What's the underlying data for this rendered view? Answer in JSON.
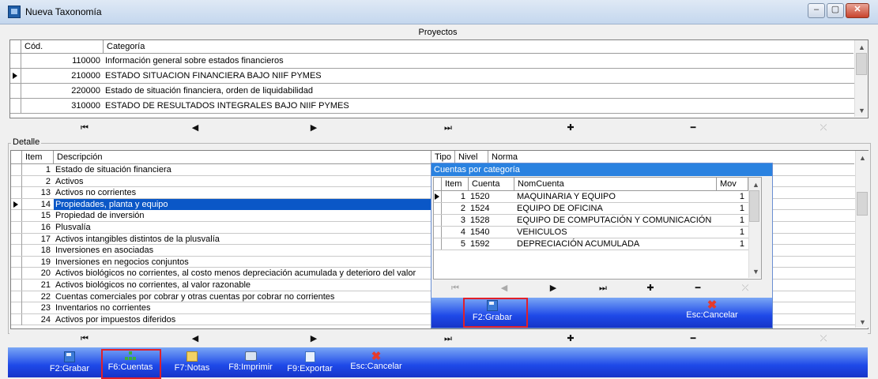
{
  "window": {
    "title": "Nueva Taxonomía",
    "min": "‒",
    "max": "▢",
    "close": "✕"
  },
  "proyectos": {
    "title": "Proyectos",
    "columns": {
      "cod": "Cód.",
      "categoria": "Categoría"
    },
    "rows": [
      {
        "cod": "110000",
        "categoria": "Información general sobre estados financieros"
      },
      {
        "cod": "210000",
        "categoria": "ESTADO SITUACION FINANCIERA BAJO NIIF PYMES"
      },
      {
        "cod": "220000",
        "categoria": "Estado de situación financiera, orden de liquidabilidad"
      },
      {
        "cod": "310000",
        "categoria": "ESTADO DE RESULTADOS INTEGRALES BAJO NIIF PYMES"
      }
    ],
    "current_row": 1
  },
  "navigator": {
    "first": "⏮",
    "prior": "◀",
    "next": "▶",
    "last": "⏭",
    "insert": "✚",
    "delete": "━",
    "cancel": "⤫"
  },
  "detalle": {
    "title": "Detalle",
    "columns": {
      "item": "Item",
      "descripcion": "Descripción",
      "tipo": "Tipo",
      "nivel": "Nivel",
      "norma": "Norma"
    },
    "rows": [
      {
        "item": "1",
        "descripcion": "Estado de situación financiera"
      },
      {
        "item": "2",
        "descripcion": "Activos"
      },
      {
        "item": "13",
        "descripcion": "Activos no corrientes"
      },
      {
        "item": "14",
        "descripcion": "Propiedades, planta y equipo"
      },
      {
        "item": "15",
        "descripcion": "Propiedad de inversión"
      },
      {
        "item": "16",
        "descripcion": "Plusvalía"
      },
      {
        "item": "17",
        "descripcion": "Activos intangibles distintos de la plusvalía"
      },
      {
        "item": "18",
        "descripcion": "Inversiones en asociadas"
      },
      {
        "item": "19",
        "descripcion": "Inversiones en negocios conjuntos"
      },
      {
        "item": "20",
        "descripcion": "Activos biológicos no corrientes, al costo menos depreciación acumulada y deterioro del valor"
      },
      {
        "item": "21",
        "descripcion": "Activos biológicos no corrientes, al valor razonable"
      },
      {
        "item": "22",
        "descripcion": "Cuentas comerciales por cobrar y otras cuentas por cobrar no corrientes"
      },
      {
        "item": "23",
        "descripcion": "Inventarios no corrientes"
      },
      {
        "item": "24",
        "descripcion": "Activos por impuestos diferidos"
      }
    ],
    "selected_row": 3
  },
  "cuentas": {
    "title": "Cuentas por categoría",
    "columns": {
      "item": "Item",
      "cuenta": "Cuenta",
      "nomcuenta": "NomCuenta",
      "mov": "Mov"
    },
    "rows": [
      {
        "item": "1",
        "cuenta": "1520",
        "nomcuenta": "MAQUINARIA Y EQUIPO",
        "mov": "1"
      },
      {
        "item": "2",
        "cuenta": "1524",
        "nomcuenta": "EQUIPO DE OFICINA",
        "mov": "1"
      },
      {
        "item": "3",
        "cuenta": "1528",
        "nomcuenta": "EQUIPO DE COMPUTACIÓN Y COMUNICACIÓN",
        "mov": "1"
      },
      {
        "item": "4",
        "cuenta": "1540",
        "nomcuenta": "VEHICULOS",
        "mov": "1"
      },
      {
        "item": "5",
        "cuenta": "1592",
        "nomcuenta": "DEPRECIACIÓN ACUMULADA",
        "mov": "1"
      }
    ],
    "save_label": "F2:Grabar",
    "cancel_label": "Esc:Cancelar"
  },
  "toolbar": {
    "save": "F2:Grabar",
    "cuentas": "F6:Cuentas",
    "notas": "F7:Notas",
    "imprimir": "F8:Imprimir",
    "exportar": "F9:Exportar",
    "cancelar": "Esc:Cancelar"
  },
  "colors": {
    "selection": "#0a57c7",
    "popup_title": "#2a82e0",
    "toolbar_blue": "#1e49e8",
    "highlight_red": "#e0202a"
  }
}
